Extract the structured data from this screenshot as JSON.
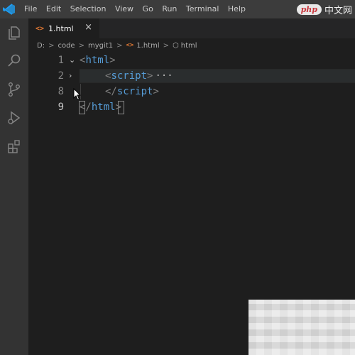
{
  "menu": {
    "items": [
      "File",
      "Edit",
      "Selection",
      "View",
      "Go",
      "Run",
      "Terminal",
      "Help"
    ]
  },
  "watermark": {
    "badge": "php",
    "text": "中文网"
  },
  "activity_bar": {
    "icons": [
      "explorer-icon",
      "search-icon",
      "source-control-icon",
      "run-debug-icon",
      "extensions-icon"
    ]
  },
  "tab": {
    "icon": "<>",
    "label": "1.html",
    "close": "×"
  },
  "breadcrumb": {
    "items": [
      "D:",
      "code",
      "mygit1",
      "1.html",
      "html"
    ],
    "separator": ">"
  },
  "editor": {
    "lines": [
      {
        "number": "1",
        "fold": "expanded",
        "open": "<",
        "tag": "html",
        "close": ">"
      },
      {
        "number": "2",
        "fold": "collapsed",
        "open": "<",
        "tag": "script",
        "close": ">",
        "folded_marker": "···"
      },
      {
        "number": "8",
        "open": "</",
        "tag": "script",
        "close": ">"
      },
      {
        "number": "9",
        "open": "</",
        "tag": "html",
        "close": ">"
      }
    ],
    "fold_glyphs": {
      "expanded": "⌄",
      "collapsed": "›"
    }
  },
  "colors": {
    "titlebar": "#3c3c3c",
    "activity_bar": "#333333",
    "editor_bg": "#1e1e1e",
    "tag": "#569cd6",
    "punctuation": "#808080",
    "html_file_icon": "#e37933"
  }
}
